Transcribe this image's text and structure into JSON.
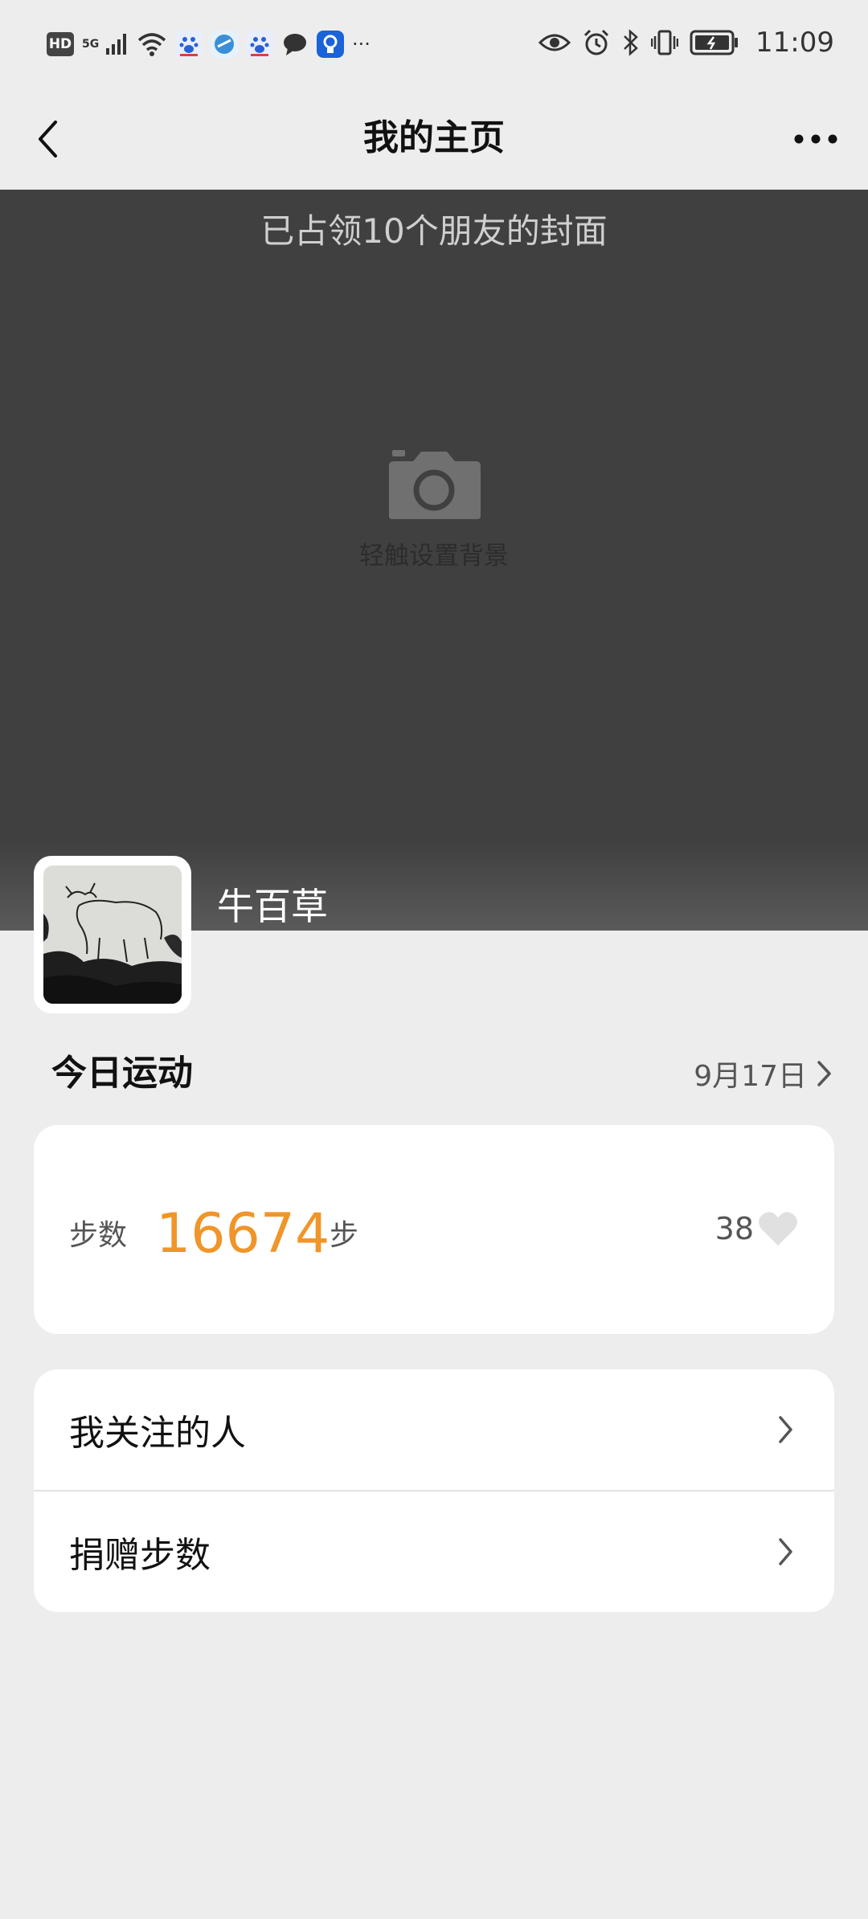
{
  "status_bar": {
    "hd_badge": "HD",
    "network_label": "5G",
    "time": "11:09",
    "icons": [
      "hd-icon",
      "signal-icon",
      "wifi-icon",
      "baidu-icon",
      "browser-icon",
      "baidu-icon",
      "message-icon",
      "bulb-app-icon",
      "more-dots-icon",
      "eye-icon",
      "alarm-icon",
      "bluetooth-icon",
      "vibrate-icon",
      "battery-icon"
    ]
  },
  "nav": {
    "title": "我的主页"
  },
  "cover": {
    "caption": "已占领10个朋友的封面",
    "hint": "轻触设置背景"
  },
  "profile": {
    "name": "牛百草"
  },
  "today": {
    "title": "今日运动",
    "date": "9月17日"
  },
  "steps": {
    "label": "步数",
    "value": "16674",
    "unit": "步",
    "likes": "38"
  },
  "menu": {
    "items": [
      {
        "label": "我关注的人"
      },
      {
        "label": "捐赠步数"
      }
    ]
  },
  "colors": {
    "accent": "#f0952a",
    "page_bg": "#ededed",
    "cover_bg": "#404040"
  }
}
